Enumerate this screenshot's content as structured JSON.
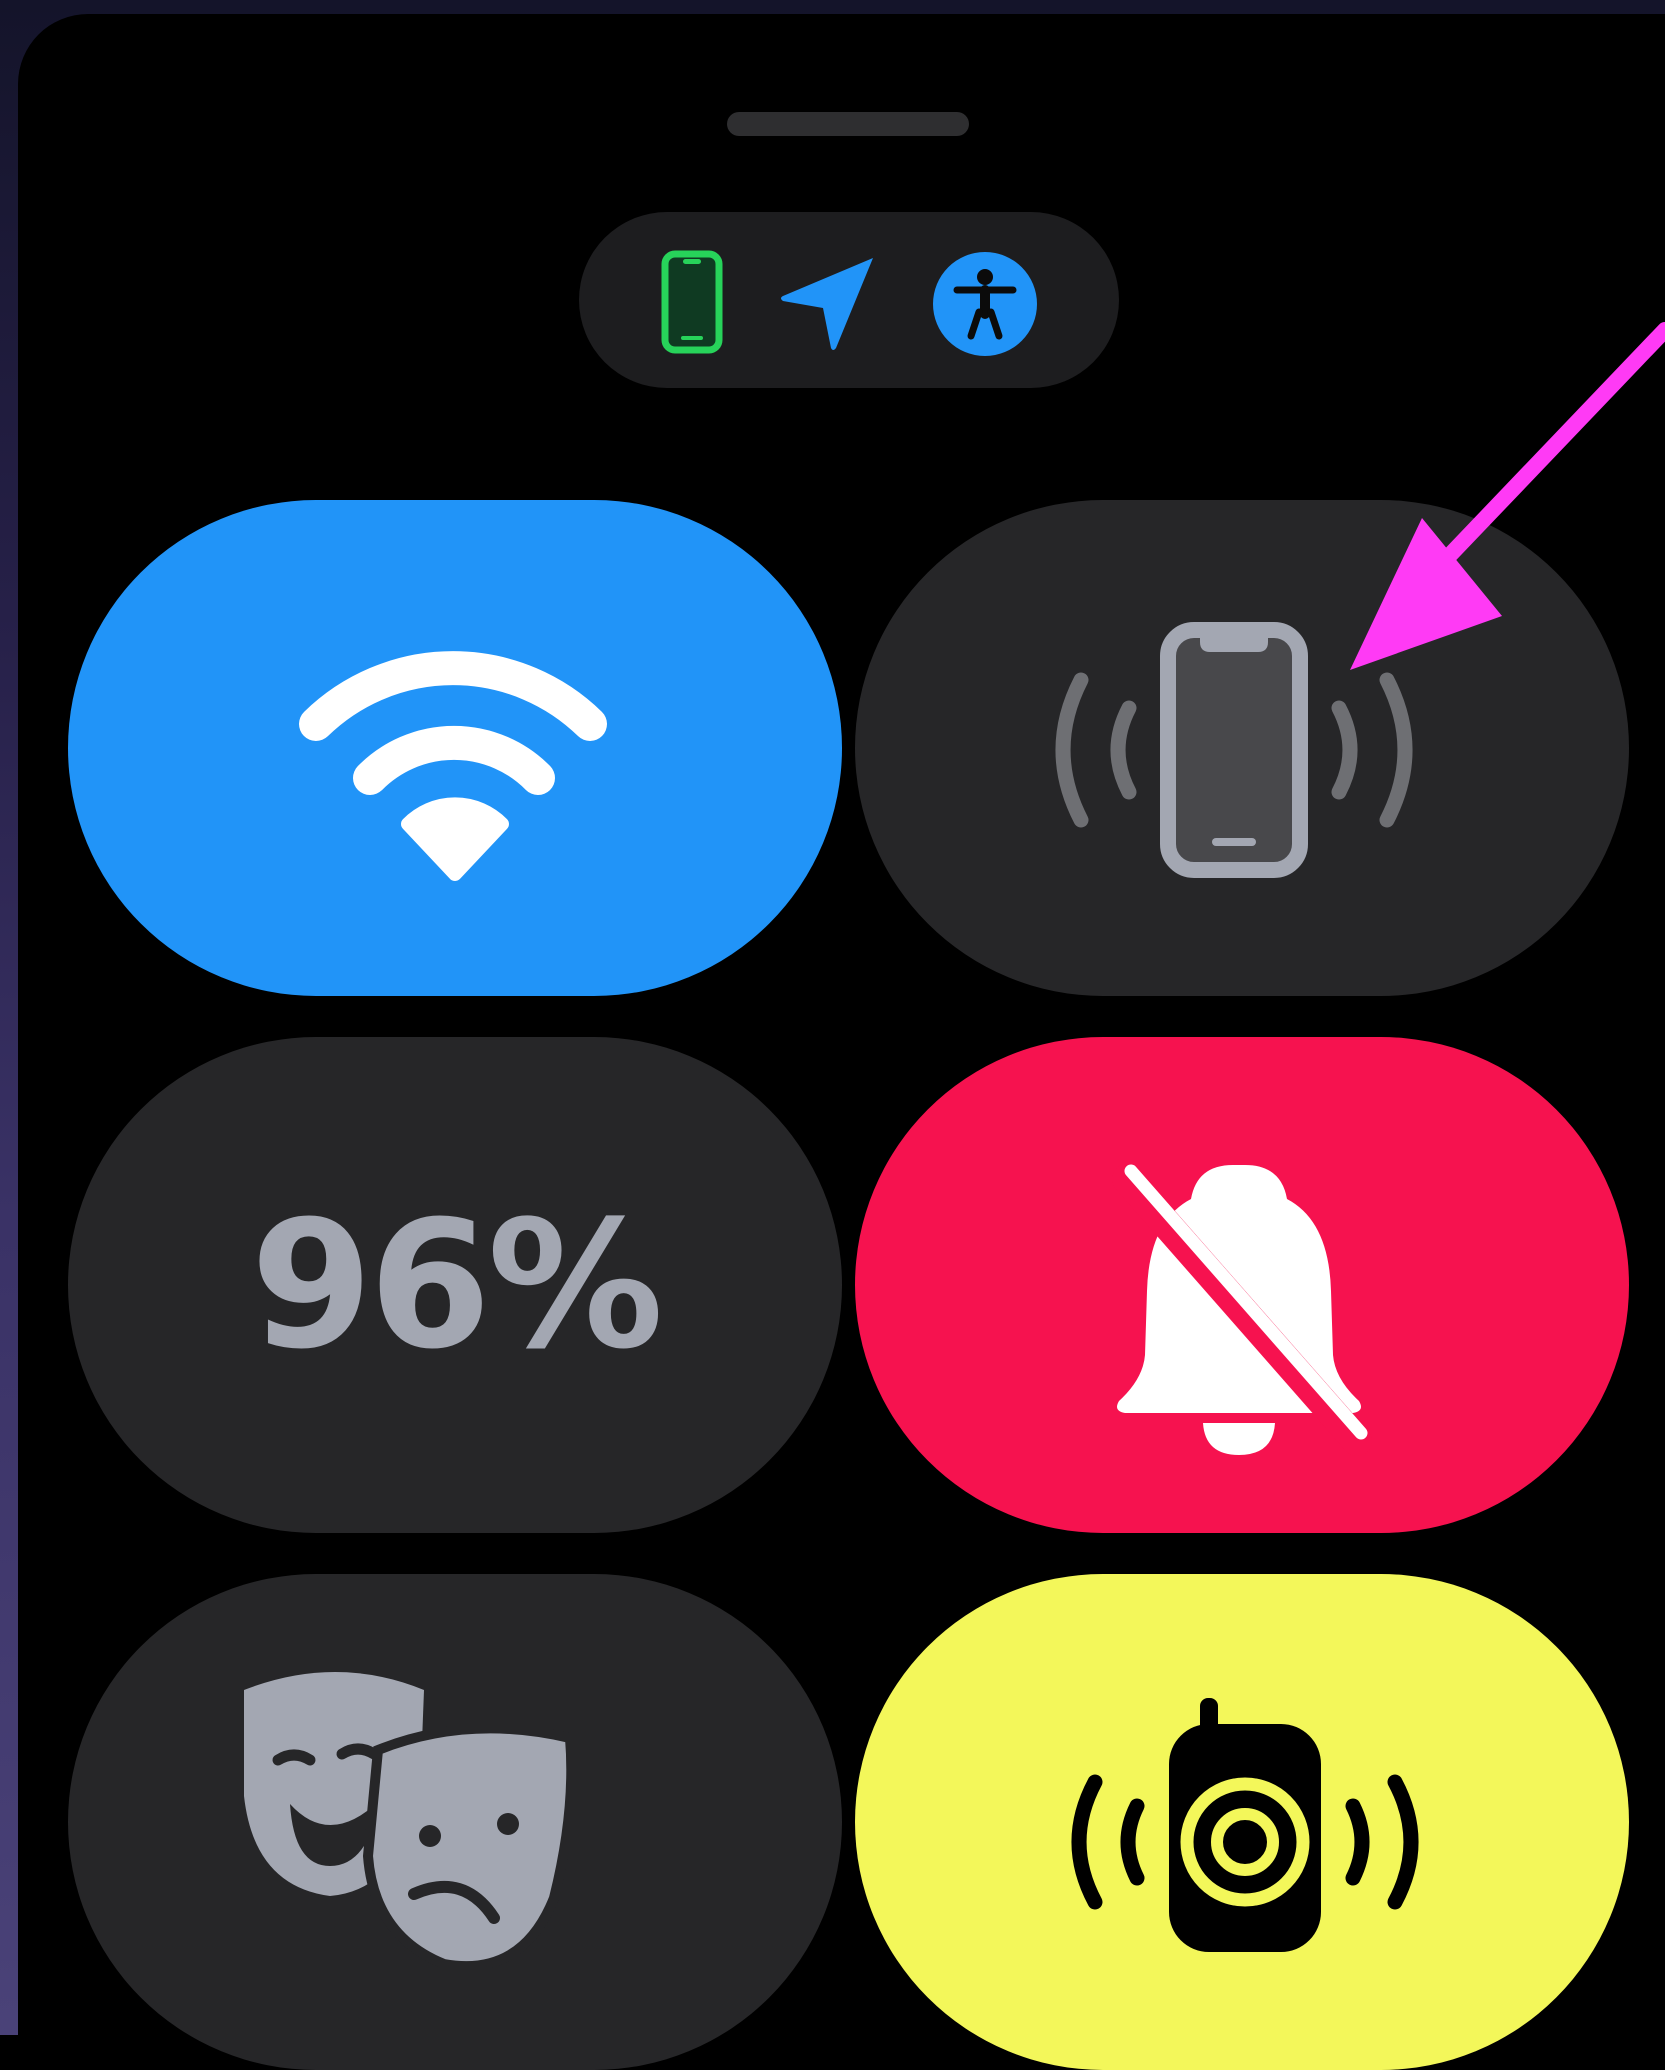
{
  "colors": {
    "wifi_on": "#2194f8",
    "silent_on": "#f6124f",
    "walkie_on": "#f3f75a",
    "tile_off": "#262628",
    "icon_gray": "#a3a7b2",
    "annotation_arrow": "#ff3af5",
    "status_phone_green": "#27d35a",
    "status_location_blue": "#2194f8"
  },
  "status_bar": {
    "icons": [
      "phone-connected-icon",
      "location-arrow-icon",
      "accessibility-icon"
    ]
  },
  "tiles": [
    {
      "id": "wifi",
      "icon": "wifi-icon",
      "state": "on"
    },
    {
      "id": "ping-iphone",
      "icon": "ping-iphone-icon",
      "state": "off"
    },
    {
      "id": "battery",
      "icon": "",
      "state": "off",
      "label": "96%"
    },
    {
      "id": "silent-mode",
      "icon": "bell-slash-icon",
      "state": "on"
    },
    {
      "id": "theater-mode",
      "icon": "theater-masks-icon",
      "state": "off"
    },
    {
      "id": "walkie-talkie",
      "icon": "walkie-talkie-icon",
      "state": "on"
    }
  ],
  "annotation": {
    "type": "arrow",
    "points_to": "ping-iphone"
  }
}
